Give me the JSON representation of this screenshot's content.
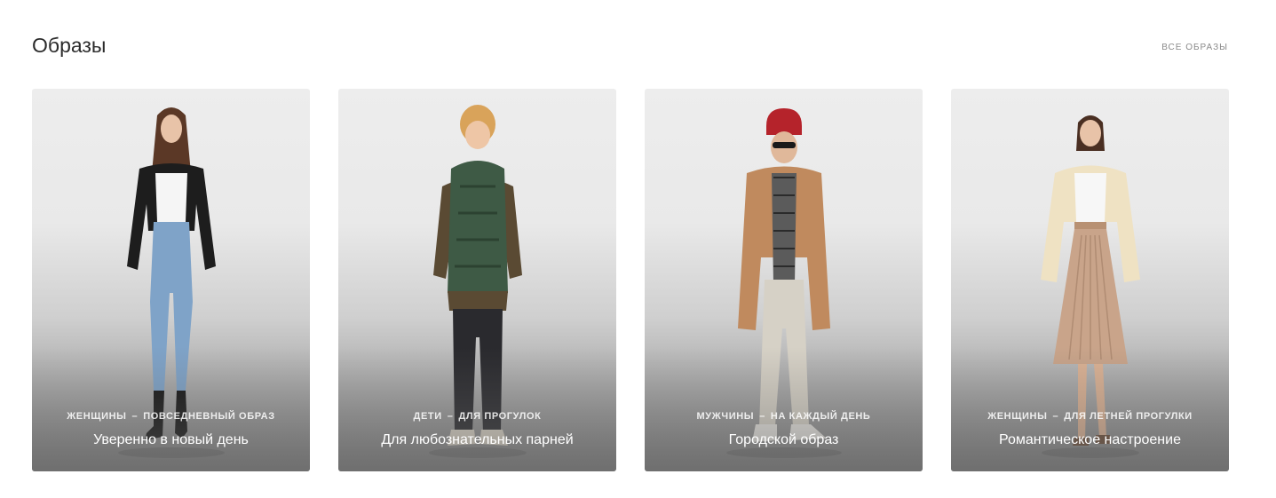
{
  "section": {
    "title": "Образы",
    "all_link": "ВСЕ ОБРАЗЫ"
  },
  "cards": [
    {
      "category": "ЖЕНЩИНЫ",
      "separator": "–",
      "subcategory": "ПОВСЕДНЕВНЫЙ ОБРАЗ",
      "title": "Уверенно в новый день"
    },
    {
      "category": "ДЕТИ",
      "separator": "–",
      "subcategory": "ДЛЯ ПРОГУЛОК",
      "title": "Для любознательных парней"
    },
    {
      "category": "МУЖЧИНЫ",
      "separator": "–",
      "subcategory": "НА КАЖДЫЙ ДЕНЬ",
      "title": "Городской образ"
    },
    {
      "category": "ЖЕНЩИНЫ",
      "separator": "–",
      "subcategory": "ДЛЯ ЛЕТНЕЙ ПРОГУЛКИ",
      "title": "Романтическое настроение"
    }
  ],
  "colors": {
    "title": "#2b2b2b",
    "link": "#8a8a8a",
    "card_background": "#ededed"
  }
}
